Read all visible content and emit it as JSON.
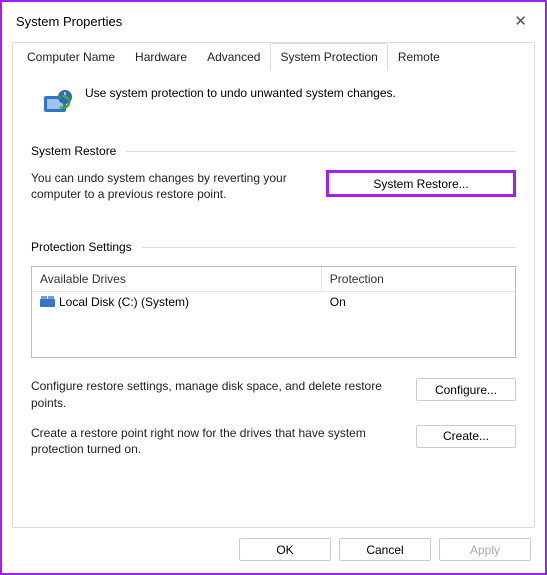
{
  "window": {
    "title": "System Properties"
  },
  "tabs": {
    "items": [
      "Computer Name",
      "Hardware",
      "Advanced",
      "System Protection",
      "Remote"
    ],
    "activeIndex": 3
  },
  "intro": "Use system protection to undo unwanted system changes.",
  "sections": {
    "restore": {
      "heading": "System Restore",
      "text": "You can undo system changes by reverting your computer to a previous restore point.",
      "button": "System Restore..."
    },
    "protection": {
      "heading": "Protection Settings",
      "col_drive": "Available Drives",
      "col_prot": "Protection",
      "rows": [
        {
          "name": "Local Disk (C:) (System)",
          "protection": "On"
        }
      ],
      "configure_text": "Configure restore settings, manage disk space, and delete restore points.",
      "configure_button": "Configure...",
      "create_text": "Create a restore point right now for the drives that have system protection turned on.",
      "create_button": "Create..."
    }
  },
  "footer": {
    "ok": "OK",
    "cancel": "Cancel",
    "apply": "Apply"
  }
}
